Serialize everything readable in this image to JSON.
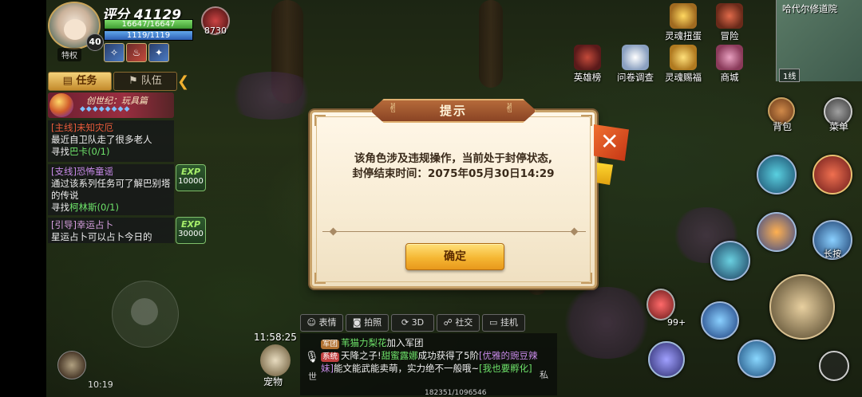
{
  "player": {
    "score_label": "评分 41129",
    "level": "40",
    "privilege": "特权",
    "hp_text": "16647/16647",
    "mp_text": "1119/1119",
    "power_value": "8730"
  },
  "quest_panel": {
    "tab_task": "任务",
    "tab_team": "队伍",
    "chapter": "创世纪：玩具篇",
    "chapter_gems": "◆◆◆◆◆◆◆◆",
    "quests": [
      {
        "title": "[主线]未知灾厄",
        "desc": "最近自卫队走了很多老人",
        "find_prefix": "寻找",
        "target": "巴卡",
        "progress": "(0/1)"
      },
      {
        "title": "[支线]恐怖童谣",
        "desc": "通过该系列任务可了解巴别塔的传说",
        "find_prefix": "寻找",
        "target": "柯林斯",
        "progress": "(0/1)",
        "exp_label": "EXP",
        "exp_value": "10000"
      },
      {
        "title": "[引导]幸运占卜",
        "desc": "星运占卜可以占卜今日的",
        "exp_label": "EXP",
        "exp_value": "30000"
      }
    ]
  },
  "top_features": [
    {
      "label": "灵魂扭蛋"
    },
    {
      "label": "冒险"
    },
    {
      "label": "英雄榜"
    },
    {
      "label": "问卷调查"
    },
    {
      "label": "灵魂赐福"
    },
    {
      "label": "商城"
    }
  ],
  "minimap": {
    "title": "哈代尔修道院",
    "line": "1线"
  },
  "side_buttons": {
    "bag": "背包",
    "menu": "菜单",
    "skill_label": "长按",
    "potion_count": "99+"
  },
  "dialog": {
    "title": "提示",
    "message_line1": "该角色涉及违规操作，当前处于封停状态,",
    "message_line2": "封停结束时间：2075年05月30日14:29",
    "confirm": "确定",
    "close": "✕"
  },
  "toolbar": [
    {
      "label": "表情"
    },
    {
      "label": "拍照"
    },
    {
      "label": "3D"
    },
    {
      "label": "社交"
    },
    {
      "label": "挂机"
    }
  ],
  "chat": {
    "world": "世",
    "private": "私",
    "lines": [
      {
        "tag": "军团",
        "name": "苇猫力梨花",
        "text": "加入军团"
      },
      {
        "tag": "系统",
        "name": "天降之子!",
        "name2": "甜蜜露娜",
        "text": "成功获得了5阶",
        "item": "[优雅的豌豆辣妹]",
        "text2": "能文能武能卖萌，实力绝不一般哦~",
        "link": "[我也要孵化]"
      }
    ]
  },
  "status": {
    "clock": "11:58:25",
    "pet": "宠物",
    "sys_time": "10:19",
    "coords": "182351/1096546"
  }
}
